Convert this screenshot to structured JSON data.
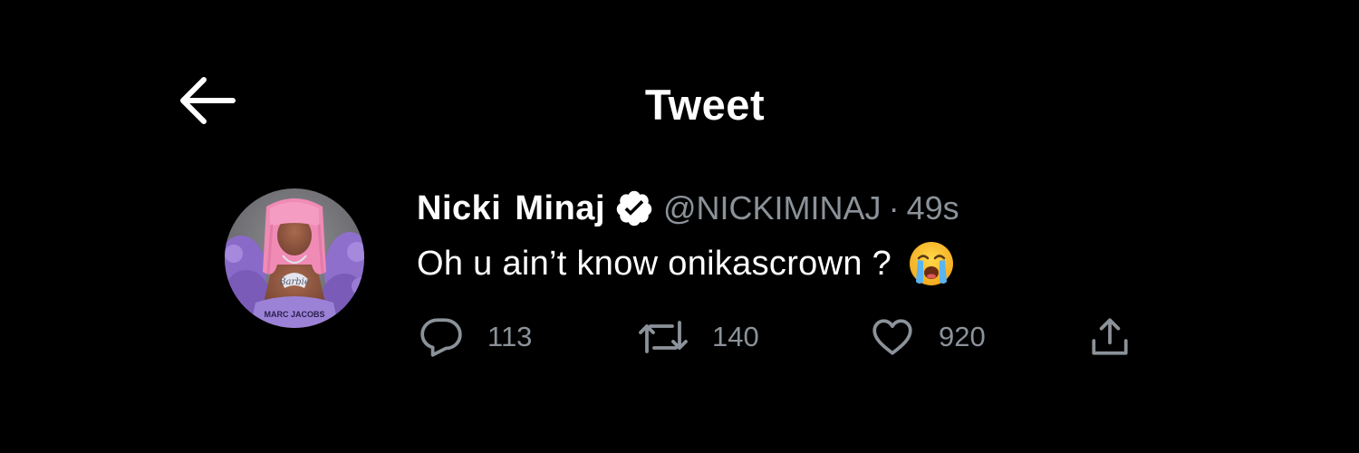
{
  "header": {
    "title": "Tweet",
    "back_icon": "arrow-left-icon"
  },
  "tweet": {
    "display_name": "Nicki Minaj",
    "handle": "@NICKIMINAJ",
    "separator": "·",
    "time": "49s",
    "text": "Oh u ain’t know onikascrown ?",
    "emoji": "loudly-crying-face-icon",
    "avatar": {
      "badge_text": "Barbie",
      "shirt_text": "MARC JACOBS"
    }
  },
  "actions": {
    "reply_count": "113",
    "retweet_count": "140",
    "like_count": "920",
    "share_icon": "share-icon"
  },
  "colors": {
    "background": "#000000",
    "primary_text": "#ffffff",
    "secondary_text": "#8b9299",
    "verified_badge": "#ffffff"
  }
}
